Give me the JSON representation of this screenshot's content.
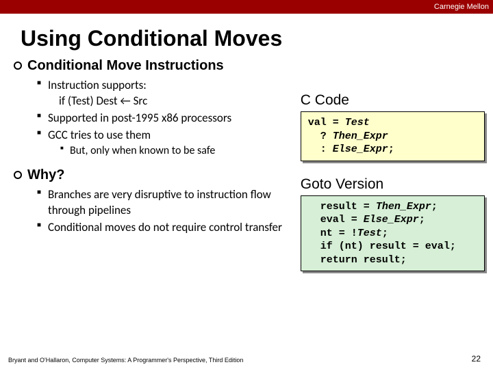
{
  "brand": "Carnegie Mellon",
  "title": "Using Conditional Moves",
  "section1": {
    "heading": "Conditional Move Instructions",
    "b1": "Instruction supports:",
    "b1_indent": "if (Test) Dest ← Src",
    "b2": "Supported in post-1995 x86 processors",
    "b3": "GCC tries to use them",
    "b3_sub": "But, only when known to be safe"
  },
  "section2": {
    "heading": "Why?",
    "b1": "Branches are very disruptive to instruction flow through pipelines",
    "b2": "Conditional moves do not require control transfer"
  },
  "ccode": {
    "title": "C Code",
    "l1a": "val = ",
    "l1b": "Test",
    "l2a": "  ? ",
    "l2b": "Then_Expr",
    "l3a": "  : ",
    "l3b": "Else_Expr",
    "l3c": ";"
  },
  "goto": {
    "title": "Goto Version",
    "l1a": "  result = ",
    "l1b": "Then_Expr",
    "l1c": ";",
    "l2a": "  eval = ",
    "l2b": "Else_Expr",
    "l2c": ";",
    "l3a": "  nt = !",
    "l3b": "Test",
    "l3c": ";",
    "l4": "  if (nt) result = eval;",
    "l5": "  return result;"
  },
  "footer": "Bryant and O'Hallaron, Computer Systems: A Programmer's Perspective, Third Edition",
  "page": "22"
}
